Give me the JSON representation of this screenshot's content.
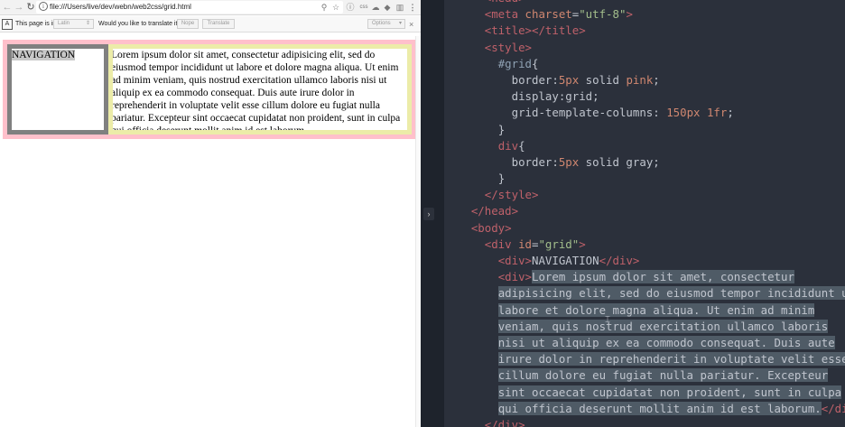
{
  "browser": {
    "url": "file:///Users/live/dev/webn/web2css/grid.html",
    "nav_icons": [
      "back-icon",
      "forward-icon",
      "reload-icon"
    ],
    "toolbar_icons": [
      "zoom-icon",
      "star-icon",
      "info-icon",
      "css-icon",
      "cloud-icon",
      "puzzle-icon",
      "extension-icon",
      "menu-icon"
    ],
    "toolbar_css_label": "css",
    "translate_bar": {
      "prefix": "This page is in",
      "language": "Latin",
      "question": "Would you like to translate it?",
      "nope": "Nope",
      "translate": "Translate",
      "options": "Options",
      "close": "×"
    },
    "page": {
      "nav_text": "NAVIGATION",
      "content_lines": [
        "Lorem ipsum dolor sit amet, consectetur adipisicing elit, sed do",
        "eiusmod tempor incididunt ut labore et dolore magna aliqua. Ut enim",
        "ad minim veniam, quis nostrud exercitation ullamco laboris nisi ut",
        "aliquip ex ea commodo consequat. Duis aute irure dolor in",
        "reprehenderit in voluptate velit esse cillum dolore eu fugiat nulla",
        "pariatur. Excepteur sint occaecat cupidatat non proident, sunt in culpa",
        "qui officia deserunt mollit anim id est laborum."
      ]
    },
    "colors": {
      "grid_border": "pink",
      "cell_border": "gray"
    }
  },
  "editor": {
    "colors": {
      "background": "#2b303b",
      "tag": "#bf616a",
      "attr": "#d08770",
      "string": "#a3be8c",
      "selection": "#4f5b66"
    },
    "lines": [
      {
        "indent": 2,
        "tokens": [
          [
            "t",
            "<head>"
          ]
        ],
        "clip": true
      },
      {
        "indent": 2,
        "tokens": [
          [
            "t",
            "<meta "
          ],
          [
            "a",
            "charset"
          ],
          [
            "w",
            "="
          ],
          [
            "s",
            "\"utf-8\""
          ],
          [
            "t",
            ">"
          ]
        ]
      },
      {
        "indent": 2,
        "tokens": [
          [
            "t",
            "<title></title>"
          ]
        ]
      },
      {
        "indent": 2,
        "tokens": [
          [
            "t",
            "<style>"
          ]
        ]
      },
      {
        "indent": 3,
        "tokens": [
          [
            "id",
            "#grid"
          ],
          [
            "w",
            "{"
          ]
        ]
      },
      {
        "indent": 4,
        "tokens": [
          [
            "w",
            "border:"
          ],
          [
            "n",
            "5px"
          ],
          [
            "w",
            " solid "
          ],
          [
            "n",
            "pink"
          ],
          [
            "w",
            ";"
          ]
        ]
      },
      {
        "indent": 4,
        "tokens": [
          [
            "w",
            "display:grid;"
          ]
        ]
      },
      {
        "indent": 4,
        "tokens": [
          [
            "w",
            "grid-template-columns: "
          ],
          [
            "n",
            "150px"
          ],
          [
            "w",
            " "
          ],
          [
            "n",
            "1fr"
          ],
          [
            "w",
            ";"
          ]
        ]
      },
      {
        "indent": 3,
        "tokens": [
          [
            "w",
            "}"
          ]
        ]
      },
      {
        "indent": 3,
        "tokens": [
          [
            "t",
            "div"
          ],
          [
            "w",
            "{"
          ]
        ]
      },
      {
        "indent": 4,
        "tokens": [
          [
            "w",
            "border:"
          ],
          [
            "n",
            "5px"
          ],
          [
            "w",
            " solid gray;"
          ]
        ]
      },
      {
        "indent": 3,
        "tokens": [
          [
            "w",
            "}"
          ]
        ]
      },
      {
        "indent": 2,
        "tokens": [
          [
            "t",
            "</style>"
          ]
        ]
      },
      {
        "indent": 1,
        "tokens": [
          [
            "t",
            "</head>"
          ]
        ]
      },
      {
        "indent": 1,
        "tokens": [
          [
            "t",
            "<body>"
          ]
        ]
      },
      {
        "indent": 2,
        "tokens": [
          [
            "t",
            "<div "
          ],
          [
            "a",
            "id"
          ],
          [
            "w",
            "="
          ],
          [
            "s",
            "\"grid\""
          ],
          [
            "t",
            ">"
          ]
        ]
      },
      {
        "indent": 3,
        "tokens": [
          [
            "t",
            "<div>"
          ],
          [
            "w",
            "NAVIGATION"
          ],
          [
            "t",
            "</div>"
          ]
        ]
      },
      {
        "indent": 3,
        "tokens": [
          [
            "t",
            "<div>"
          ],
          [
            "w",
            "Lorem ipsum dolor sit amet, consectetur"
          ]
        ],
        "sel_from": 1
      },
      {
        "indent": 3,
        "tokens": [
          [
            "w",
            "adipisicing elit, sed do eiusmod tempor incididunt ut"
          ]
        ],
        "sel": true
      },
      {
        "indent": 3,
        "tokens": [
          [
            "w",
            "labore et dolore magna aliqua. Ut enim ad minim"
          ]
        ],
        "sel": true
      },
      {
        "indent": 3,
        "tokens": [
          [
            "w",
            "veniam, quis nostrud exercitation ullamco laboris"
          ]
        ],
        "sel": true
      },
      {
        "indent": 3,
        "tokens": [
          [
            "w",
            "nisi ut aliquip ex ea commodo consequat. Duis aute"
          ]
        ],
        "sel": true
      },
      {
        "indent": 3,
        "tokens": [
          [
            "w",
            "irure dolor in reprehenderit in voluptate velit esse"
          ]
        ],
        "sel": true
      },
      {
        "indent": 3,
        "tokens": [
          [
            "w",
            "cillum dolore eu fugiat nulla pariatur. Excepteur"
          ]
        ],
        "sel": true
      },
      {
        "indent": 3,
        "tokens": [
          [
            "w",
            "sint occaecat cupidatat non proident, sunt in culpa"
          ]
        ],
        "sel": true
      },
      {
        "indent": 3,
        "tokens": [
          [
            "w",
            "qui officia deserunt mollit anim id est laborum."
          ],
          [
            "t",
            "</div>"
          ]
        ],
        "sel_to": 1
      },
      {
        "indent": 2,
        "tokens": [
          [
            "t",
            "</div>"
          ]
        ]
      }
    ]
  }
}
